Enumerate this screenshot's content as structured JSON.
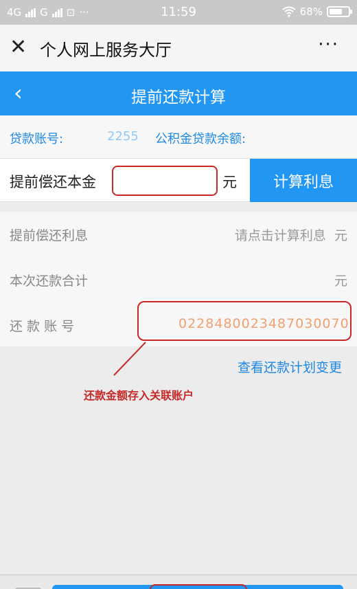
{
  "status_bar": {
    "network1": "4G",
    "network2": "G",
    "extra_icon": "⊡",
    "dots": "···",
    "time": "11:59",
    "battery": "68%",
    "battery_level": 0.68
  },
  "title_bar": {
    "title": "个人网上服务大厅",
    "close_glyph": "✕",
    "more_glyph": "···"
  },
  "nav_bar": {
    "title": "提前还款计算",
    "back_glyph": "‹"
  },
  "loan_info": {
    "account_label": "贷款账号:",
    "account_value": "2255",
    "balance_label": "公积金贷款余额:"
  },
  "prepay": {
    "label": "提前偿还本金",
    "input_value": "",
    "unit": "元",
    "calc_button": "计算利息"
  },
  "details": {
    "interest_label": "提前偿还利息",
    "interest_value": "请点击计算利息  元",
    "total_label": "本次还款合计",
    "total_value": "元",
    "repay_account_label": "还 款 账 号",
    "repay_account_value": "0228480023487030070"
  },
  "plan_link": "查看还款计划变更",
  "annotation": "还款金额存入关联账户",
  "colors": {
    "primary": "#2196f3",
    "highlight": "#c62828"
  }
}
